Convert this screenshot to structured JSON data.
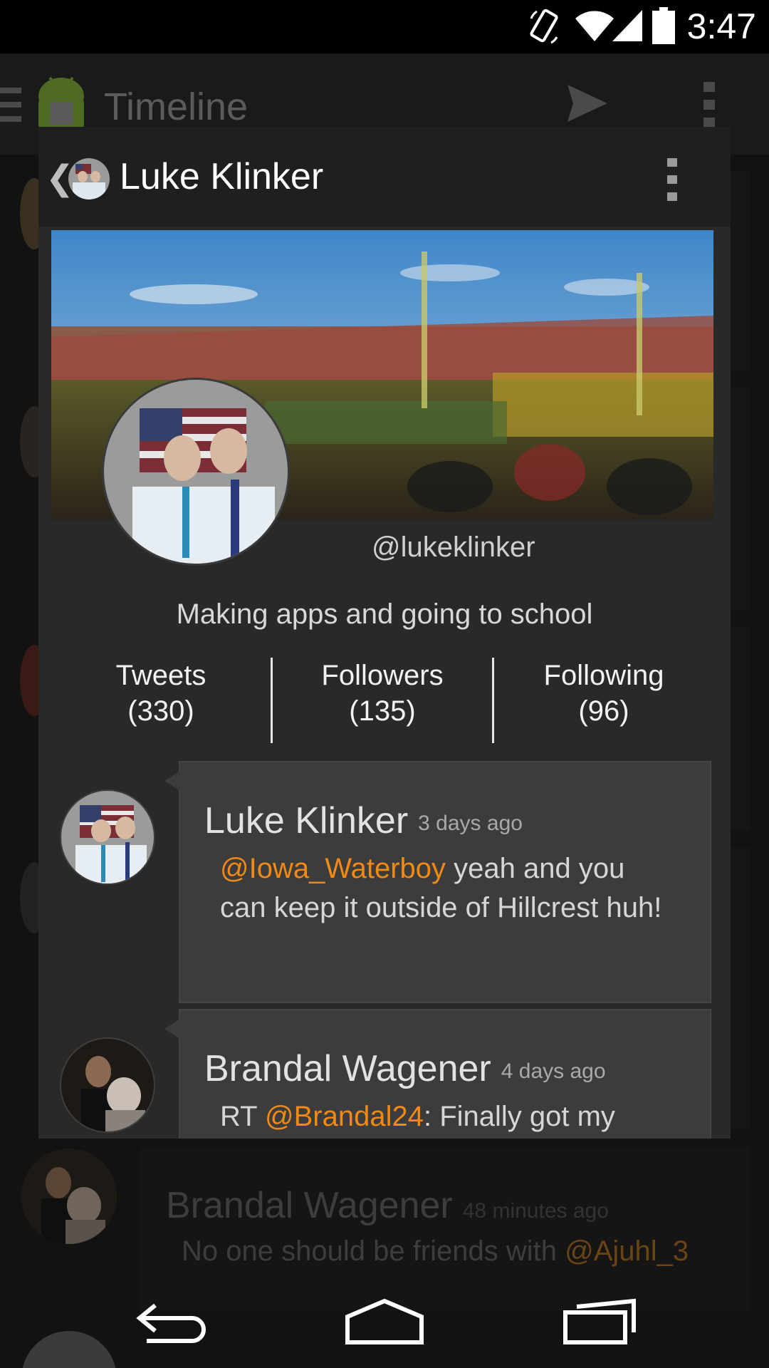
{
  "status_bar": {
    "time": "3:47"
  },
  "app_bar": {
    "title": "Timeline"
  },
  "profile": {
    "name": "Luke Klinker",
    "handle": "@lukeklinker",
    "bio": "Making apps and going to school",
    "stats": [
      {
        "label": "Tweets",
        "count": "(330)"
      },
      {
        "label": "Followers",
        "count": "(135)"
      },
      {
        "label": "Following",
        "count": "(96)"
      }
    ]
  },
  "tweets": [
    {
      "author": "Luke Klinker",
      "time": "3 days ago",
      "mention": "@Iowa_Waterboy",
      "text": " yeah and you can keep it outside of Hillcrest huh!"
    },
    {
      "author": "Brandal Wagener",
      "time": "4 days ago",
      "prefix": "RT ",
      "mention": "@Brandal24",
      "text": ": Finally got my"
    }
  ],
  "background_tweet": {
    "author": "Brandal Wagener",
    "time": "48 minutes ago",
    "text": "No one should be friends with ",
    "mention": "@Ajuhl_3"
  },
  "colors": {
    "mention": "#f08a14",
    "dialog_bg": "#292929",
    "card_bg": "#3c3c3c"
  }
}
